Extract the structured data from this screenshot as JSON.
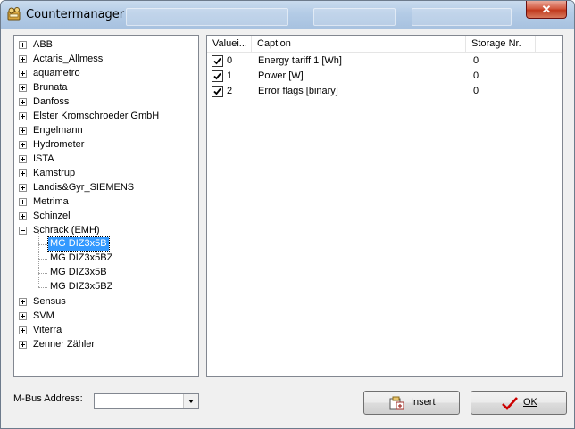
{
  "window": {
    "title": "Countermanager",
    "close_label": "✕"
  },
  "tree": {
    "manufacturers": [
      {
        "label": "ABB"
      },
      {
        "label": "Actaris_Allmess"
      },
      {
        "label": "aquametro"
      },
      {
        "label": "Brunata"
      },
      {
        "label": "Danfoss"
      },
      {
        "label": "Elster Kromschroeder GmbH"
      },
      {
        "label": "Engelmann"
      },
      {
        "label": "Hydrometer"
      },
      {
        "label": "ISTA"
      },
      {
        "label": "Kamstrup"
      },
      {
        "label": "Landis&Gyr_SIEMENS"
      },
      {
        "label": "Metrima"
      },
      {
        "label": "Schinzel"
      },
      {
        "label": "Schrack (EMH)",
        "expanded": true,
        "children": [
          {
            "label": "MG DIZ3x5B",
            "selected": true
          },
          {
            "label": "MG DIZ3x5BZ"
          },
          {
            "label": "MG DIZ3x5B"
          },
          {
            "label": "MG DIZ3x5BZ"
          }
        ]
      },
      {
        "label": "Sensus"
      },
      {
        "label": "SVM"
      },
      {
        "label": "Viterra"
      },
      {
        "label": "Zenner Zähler"
      }
    ]
  },
  "list": {
    "columns": [
      "Valuei...",
      "Caption",
      "Storage Nr."
    ],
    "rows": [
      {
        "checked": true,
        "value_index": "0",
        "caption": "Energy tariff 1 [Wh]",
        "storage": "0"
      },
      {
        "checked": true,
        "value_index": "1",
        "caption": "Power [W]",
        "storage": "0"
      },
      {
        "checked": true,
        "value_index": "2",
        "caption": "Error flags [binary]",
        "storage": "0"
      }
    ]
  },
  "footer": {
    "mbus_label": "M-Bus Address:",
    "mbus_value": "",
    "insert_label": "Insert",
    "ok_label": "OK"
  },
  "icons": {
    "app": "countermanager-icon",
    "insert": "insert-icon",
    "ok": "checkmark-icon",
    "dropdown": "chevron-down-icon"
  },
  "colors": {
    "selection": "#3399ff",
    "ok_check": "#cc0000",
    "close_button": "#c0391d",
    "titlebar": "#b3cbe6"
  }
}
